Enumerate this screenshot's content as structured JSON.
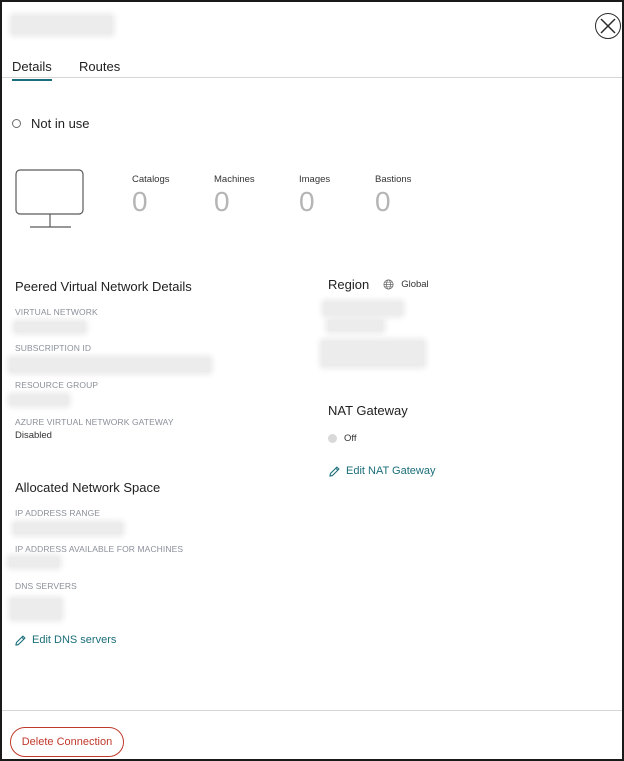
{
  "header": {
    "title_redacted": true,
    "close_icon": "close-icon"
  },
  "tabs": [
    {
      "label": "Details",
      "active": true
    },
    {
      "label": "Routes",
      "active": false
    }
  ],
  "status": {
    "label": "Not in use"
  },
  "stats": [
    {
      "label": "Catalogs",
      "value": "0"
    },
    {
      "label": "Machines",
      "value": "0"
    },
    {
      "label": "Images",
      "value": "0"
    },
    {
      "label": "Bastions",
      "value": "0"
    }
  ],
  "peered": {
    "title": "Peered Virtual Network Details",
    "virtual_network_label": "VIRTUAL NETWORK",
    "subscription_id_label": "SUBSCRIPTION ID",
    "resource_group_label": "RESOURCE GROUP",
    "gateway_label": "AZURE VIRTUAL NETWORK GATEWAY",
    "gateway_value": "Disabled"
  },
  "allocated": {
    "title": "Allocated Network Space",
    "ip_range_label": "IP ADDRESS RANGE",
    "ip_available_label": "IP ADDRESS AVAILABLE FOR MACHINES",
    "dns_label": "DNS SERVERS",
    "edit_dns_label": "Edit DNS servers"
  },
  "region": {
    "title": "Region",
    "value": "Global",
    "icon": "globe-icon"
  },
  "nat": {
    "title": "NAT Gateway",
    "state": "Off",
    "edit_label": "Edit NAT Gateway"
  },
  "footer": {
    "delete_label": "Delete Connection"
  },
  "colors": {
    "accent": "#1b6e7a",
    "danger": "#c0392b",
    "stat_value": "#b5b5b5",
    "field_label": "#8a8f99"
  }
}
